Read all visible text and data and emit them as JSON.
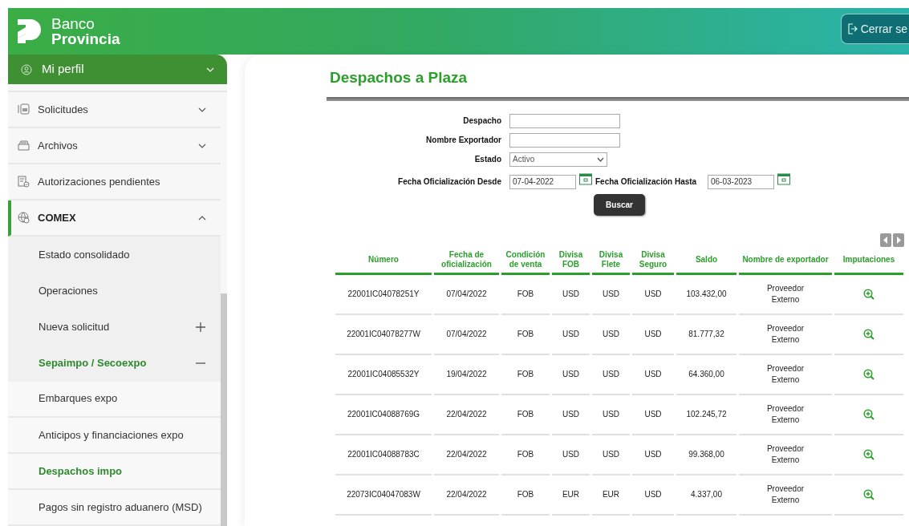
{
  "header": {
    "brand_line1": "Banco",
    "brand_line2": "Provincia",
    "logout_label": "Cerrar se"
  },
  "sidebar": {
    "profile": {
      "label": "Mi perfil",
      "expanded": false
    },
    "items": [
      {
        "label": "Solicitudes",
        "expanded": false,
        "selected": false
      },
      {
        "label": "Archivos",
        "expanded": false,
        "selected": false
      },
      {
        "label": "Autorizaciones pendientes",
        "selected": false
      },
      {
        "label": "COMEX",
        "expanded": true,
        "selected": true,
        "children": [
          {
            "label": "Estado consolidado",
            "selected": false
          },
          {
            "label": "Operaciones",
            "selected": false
          },
          {
            "label": "Nueva solicitud",
            "expanded": false,
            "selected": false
          },
          {
            "label": "Sepaimpo / Secoexpo",
            "expanded": true,
            "selected": true,
            "children": [
              {
                "label": "Embarques expo",
                "selected": false
              },
              {
                "label": "Anticipos y financiaciones expo",
                "selected": false
              },
              {
                "label": "Despachos impo",
                "selected": true
              },
              {
                "label": "Pagos sin registro aduanero (MSD)",
                "selected": false
              }
            ]
          }
        ]
      }
    ]
  },
  "page": {
    "title": "Despachos a Plaza"
  },
  "form": {
    "despacho": {
      "label": "Despacho"
    },
    "exportador": {
      "label": "Nombre Exportador"
    },
    "estado": {
      "label": "Estado",
      "value": "Activo"
    },
    "desde": {
      "label": "Fecha Oficialización Desde",
      "value": "07-04-2022"
    },
    "hasta": {
      "label": "Fecha Oficialización Hasta",
      "value": "06-03-2023"
    },
    "submit": "Buscar"
  },
  "table": {
    "columns": [
      "Número",
      "Fecha de oficialización",
      "Condición de venta",
      "Divisa FOB",
      "Divisa Flete",
      "Divisa Seguro",
      "Saldo",
      "Nombre de exportador",
      "Imputaciones"
    ],
    "rows": [
      [
        "22001IC04078251Y",
        "07/04/2022",
        "FOB",
        "USD",
        "USD",
        "USD",
        "103.432,00",
        "Proveedor Externo"
      ],
      [
        "22001IC04078277W",
        "07/04/2022",
        "FOB",
        "USD",
        "USD",
        "USD",
        "81.777,32",
        "Proveedor Externo"
      ],
      [
        "22001IC04085532Y",
        "19/04/2022",
        "FOB",
        "USD",
        "USD",
        "USD",
        "64.360,00",
        "Proveedor Externo"
      ],
      [
        "22001IC04088769G",
        "22/04/2022",
        "FOB",
        "USD",
        "USD",
        "USD",
        "102.245,72",
        "Proveedor Externo"
      ],
      [
        "22001IC04088783C",
        "22/04/2022",
        "FOB",
        "USD",
        "USD",
        "USD",
        "99.368,00",
        "Proveedor Externo"
      ],
      [
        "22073IC04047083W",
        "22/04/2022",
        "FOB",
        "EUR",
        "EUR",
        "USD",
        "4.337,00",
        "Proveedor Externo"
      ]
    ]
  }
}
